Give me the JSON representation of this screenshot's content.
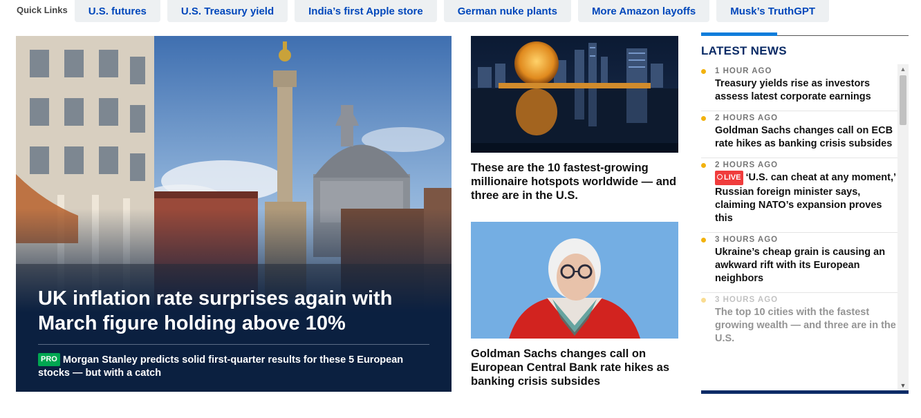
{
  "quick_links": {
    "label": "Quick Links",
    "items": [
      {
        "label": "U.S. futures"
      },
      {
        "label": "U.S. Treasury yield"
      },
      {
        "label": "India’s first Apple store"
      },
      {
        "label": "German nuke plants"
      },
      {
        "label": "More Amazon layoffs"
      },
      {
        "label": "Musk’s TruthGPT"
      }
    ]
  },
  "hero": {
    "title": "UK inflation rate surprises again with March figure holding above 10%",
    "badge": "PRO",
    "subheadline": "Morgan Stanley predicts solid first-quarter results for these 5 European stocks — but with a catch"
  },
  "cards": [
    {
      "title": "These are the 10 fastest-growing millionaire hotspots worldwide — and three are in the U.S."
    },
    {
      "title": "Goldman Sachs changes call on European Central Bank rate hikes as banking crisis subsides"
    }
  ],
  "latest_news": {
    "title": "LATEST NEWS",
    "live_label": "LIVE",
    "items": [
      {
        "time": "1 HOUR AGO",
        "headline": "Treasury yields rise as investors assess latest corporate earnings"
      },
      {
        "time": "2 HOURS AGO",
        "headline": "Goldman Sachs changes call on ECB rate hikes as banking crisis subsides"
      },
      {
        "time": "2 HOURS AGO",
        "headline": "‘U.S. can cheat at any moment,’ Russian foreign minister says, claiming NATO’s expansion proves this",
        "live": true
      },
      {
        "time": "3 HOURS AGO",
        "headline": "Ukraine’s cheap grain is causing an awkward rift with its European neighbors"
      },
      {
        "time": "3 HOURS AGO",
        "headline": "The top 10 cities with the fastest growing wealth — and three are in the U.S."
      }
    ]
  },
  "colors": {
    "link_blue": "#0047bb",
    "navy": "#0b2b66",
    "accent_blue": "#0f7ddb",
    "time_dot": "#f2b20d",
    "pro_green": "#00a651",
    "live_red": "#f03c3c"
  },
  "icons": {
    "scroll_up": "▲",
    "scroll_down": "▼"
  }
}
